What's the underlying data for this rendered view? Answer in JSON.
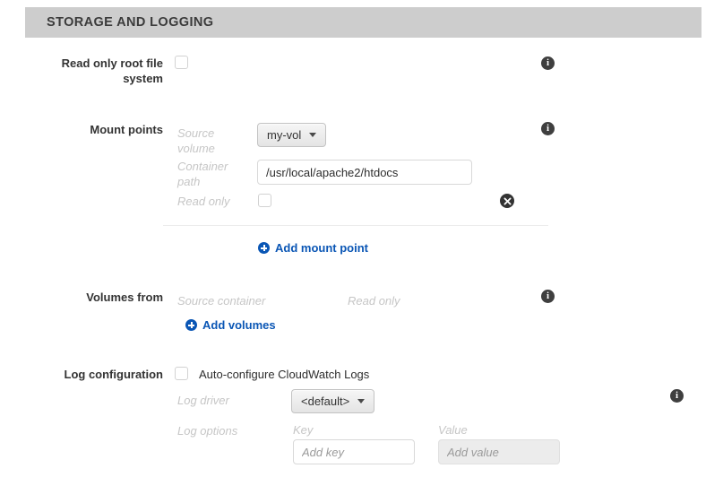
{
  "section": {
    "title": "STORAGE AND LOGGING"
  },
  "read_only_root": {
    "label": "Read only root file system",
    "checkbox_checked": false,
    "info_icon": "info-icon"
  },
  "mount_points": {
    "label": "Mount points",
    "info_icon": "info-icon",
    "rows": [
      {
        "source_volume_label": "Source volume",
        "source_volume_value": "my-vol",
        "container_path_label": "Container path",
        "container_path_value": "/usr/local/apache2/htdocs",
        "read_only_label": "Read only",
        "read_only_checked": false,
        "remove_icon": "remove-circle-icon"
      }
    ],
    "add_link": "Add mount point"
  },
  "volumes_from": {
    "label": "Volumes from",
    "column_headers": [
      "Source container",
      "Read only"
    ],
    "add_link": "Add volumes",
    "info_icon": "info-icon"
  },
  "log_configuration": {
    "label": "Log configuration",
    "auto_configure_label": "Auto-configure CloudWatch Logs",
    "auto_configure_checked": false,
    "log_driver_label": "Log driver",
    "log_driver_value": "<default>",
    "log_options_label": "Log options",
    "key_label": "Key",
    "value_label": "Value",
    "key_placeholder": "Add key",
    "key_value": "",
    "value_placeholder": "Add value",
    "value_value": "",
    "info_icon": "info-icon"
  },
  "colors": {
    "header_bg": "#cdcdcd",
    "link_blue": "#0a56b5",
    "muted_italic": "#c6c6c6",
    "label_dark": "#333333",
    "info_dark": "#3f3f3f"
  }
}
